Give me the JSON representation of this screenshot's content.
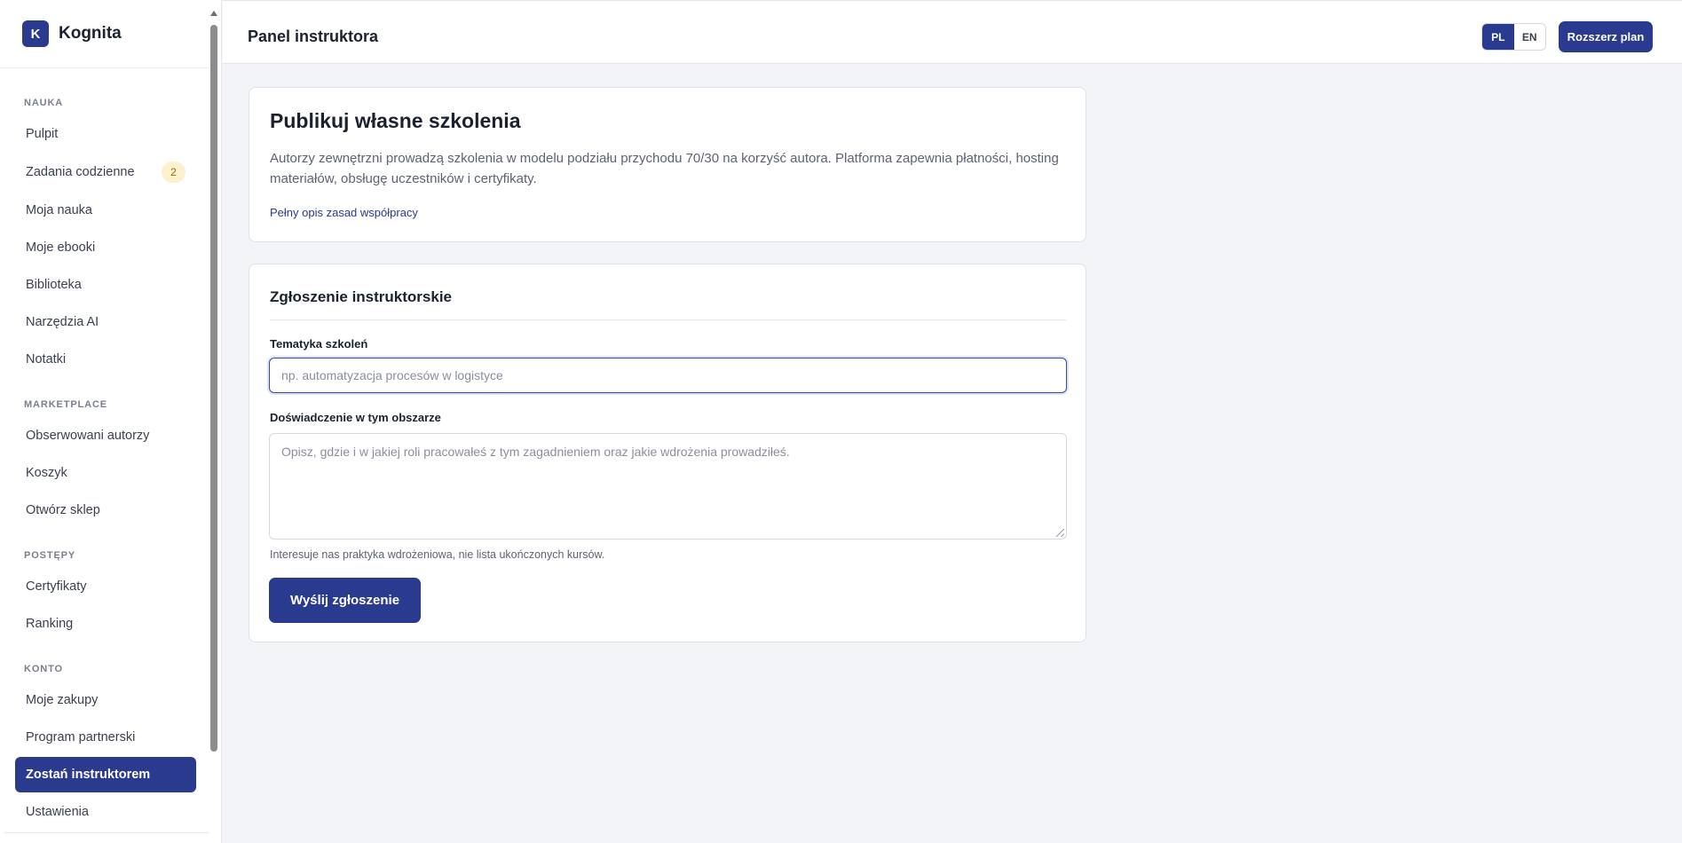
{
  "app": {
    "logo_letter": "K",
    "name": "Kognita"
  },
  "header": {
    "title": "Panel instruktora",
    "lang": {
      "pl": "PL",
      "en": "EN",
      "active": "PL"
    },
    "upgrade_label": "Rozszerz plan"
  },
  "sidebar": {
    "sections": {
      "nauka": "NAUKA",
      "marketplace": "MARKETPLACE",
      "postepy": "POSTĘPY",
      "konto": "KONTO"
    },
    "items": {
      "pulpit": "Pulpit",
      "zadania": "Zadania codzienne",
      "zadania_badge": "2",
      "moja_nauka": "Moja nauka",
      "ebooki": "Moje ebooki",
      "biblioteka": "Biblioteka",
      "narzedzia": "Narzędzia AI",
      "notatki": "Notatki",
      "obserwowani": "Obserwowani autorzy",
      "koszyk": "Koszyk",
      "sklep": "Otwórz sklep",
      "certyfikaty": "Certyfikaty",
      "ranking": "Ranking",
      "zakupy": "Moje zakupy",
      "partnerski": "Program partnerski",
      "instruktor": "Zostań instruktorem",
      "ustawienia": "Ustawienia"
    },
    "active": "instruktor"
  },
  "intro": {
    "title": "Publikuj własne szkolenia",
    "description": "Autorzy zewnętrzni prowadzą szkolenia w modelu podziału przychodu 70/30 na korzyść autora. Platforma zapewnia płatności, hosting materiałów, obsługę uczestników i certyfikaty.",
    "link": "Pełny opis zasad współpracy"
  },
  "form": {
    "title": "Zgłoszenie instruktorskie",
    "topic_label": "Tematyka szkoleń",
    "topic_placeholder": "np. automatyzacja procesów w logistyce",
    "experience_label": "Doświadczenie w tym obszarze",
    "experience_placeholder": "Opisz, gdzie i w jakiej roli pracowałeś z tym zagadnieniem oraz jakie wdrożenia prowadziłeś.",
    "hint": "Interesuje nas praktyka wdrożeniowa, nie lista ukończonych kursów.",
    "submit_label": "Wyślij zgłoszenie"
  },
  "colors": {
    "accent": "#2a3a8e",
    "badge_bg": "#fdf0cc",
    "page_bg": "#f3f4f7"
  }
}
